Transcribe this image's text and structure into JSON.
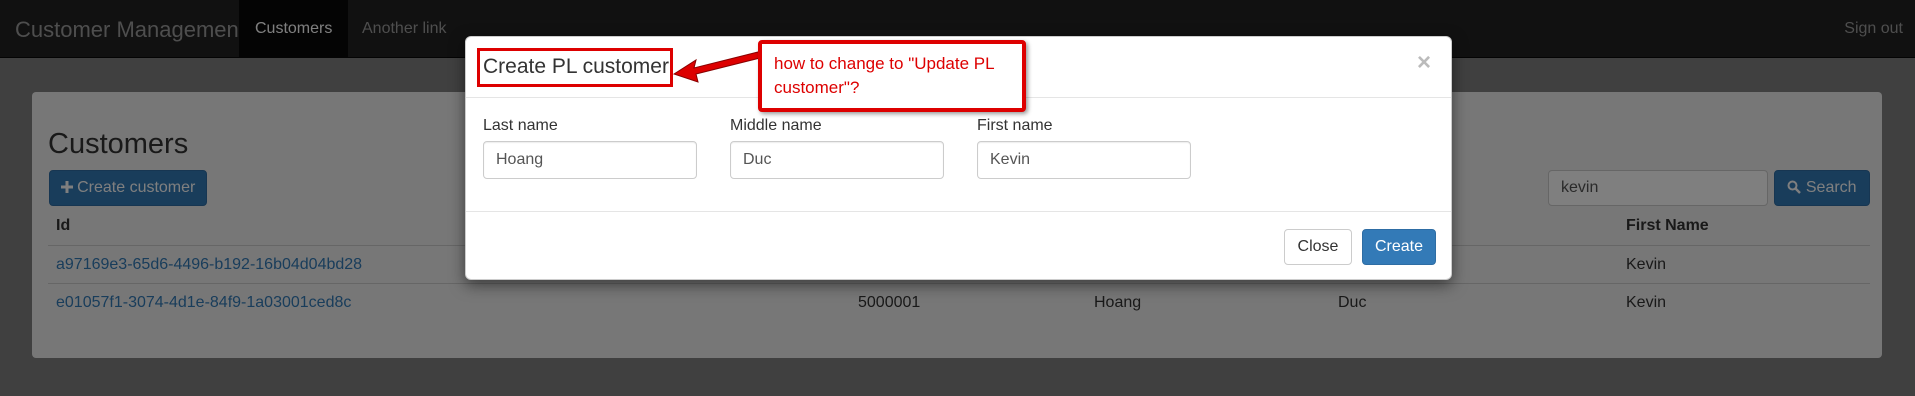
{
  "navbar": {
    "brand": "Customer Management",
    "links": [
      {
        "label": "Customers",
        "active": true
      },
      {
        "label": "Another link",
        "active": false
      }
    ],
    "sign_out": "Sign out"
  },
  "page": {
    "title": "Customers",
    "create_button": {
      "icon": "plus-icon",
      "label": "Create customer"
    },
    "search": {
      "value": "kevin",
      "button_icon": "search-icon",
      "button_label": "Search"
    },
    "table": {
      "headers": [
        "Id",
        "First Name"
      ],
      "rows": [
        {
          "id": "a97169e3-65d6-4496-b192-16b04d04bd28",
          "col2": "",
          "col3": "",
          "col4": "",
          "first_name": "Kevin"
        },
        {
          "id": "e01057f1-3074-4d1e-84f9-1a03001ced8c",
          "col2": "5000001",
          "col3": "Hoang",
          "col4": "Duc",
          "first_name": "Kevin"
        }
      ]
    }
  },
  "modal": {
    "title": "Create PL customer",
    "close_icon": "close-icon",
    "close_symbol": "×",
    "fields": [
      {
        "label": "Last name",
        "value": "Hoang"
      },
      {
        "label": "Middle name",
        "value": "Duc"
      },
      {
        "label": "First name",
        "value": "Kevin"
      }
    ],
    "close_button": "Close",
    "create_button": "Create"
  },
  "annotation": {
    "callout_text": "how to change to \"Update PL customer\"?",
    "color": "#dd0000"
  },
  "colors": {
    "primary": "#337ab7",
    "navbar": "#222222"
  }
}
